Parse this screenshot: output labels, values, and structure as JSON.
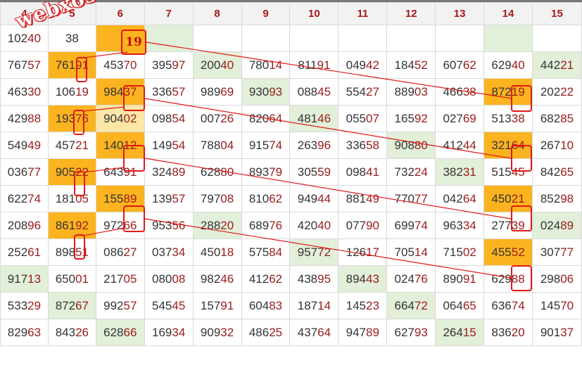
{
  "columns": [
    "4",
    "5",
    "6",
    "7",
    "8",
    "9",
    "10",
    "11",
    "12",
    "13",
    "14",
    "15"
  ],
  "rows": [
    [
      "10240",
      "38",
      "",
      "",
      "",
      "",
      "",
      "",
      "",
      "",
      "",
      ""
    ],
    [
      "76757",
      "76191",
      "45370",
      "39597",
      "20040",
      "78014",
      "81191",
      "04942",
      "18452",
      "60762",
      "62940",
      "44221"
    ],
    [
      "46330",
      "10619",
      "98437",
      "33657",
      "98969",
      "93093",
      "08845",
      "55427",
      "88903",
      "46638",
      "87219",
      "20222"
    ],
    [
      "42988",
      "19376",
      "90402",
      "09854",
      "00726",
      "82064",
      "48146",
      "05507",
      "16592",
      "02769",
      "51338",
      "68285"
    ],
    [
      "54949",
      "45721",
      "14012",
      "14954",
      "78804",
      "91574",
      "26396",
      "33658",
      "90880",
      "41244",
      "32164",
      "26710"
    ],
    [
      "03677",
      "90522",
      "64391",
      "32489",
      "62880",
      "89379",
      "30559",
      "09841",
      "73224",
      "38231",
      "51545",
      "84265"
    ],
    [
      "62274",
      "18105",
      "15589",
      "13957",
      "79708",
      "81062",
      "94944",
      "88149",
      "77077",
      "04264",
      "45021",
      "85298"
    ],
    [
      "20896",
      "86192",
      "97266",
      "95356",
      "28820",
      "68976",
      "42040",
      "07790",
      "69974",
      "96334",
      "27739",
      "02489"
    ],
    [
      "25261",
      "89851",
      "08627",
      "03734",
      "45018",
      "57584",
      "95772",
      "12617",
      "70514",
      "71502",
      "45552",
      "30777"
    ],
    [
      "91713",
      "65001",
      "21705",
      "08008",
      "98246",
      "41262",
      "43895",
      "89443",
      "02476",
      "89091",
      "62988",
      "29806"
    ],
    [
      "53329",
      "87267",
      "99257",
      "54545",
      "15791",
      "60483",
      "18714",
      "14523",
      "66472",
      "06465",
      "63674",
      "14570"
    ],
    [
      "82963",
      "84326",
      "62866",
      "16934",
      "90932",
      "48625",
      "43764",
      "94789",
      "62793",
      "26415",
      "83620",
      "90137"
    ]
  ],
  "highlight_number": "19",
  "watermark": "webxoso.net",
  "colors": {
    "header_text": "#a81818",
    "orange": "#fbb41f",
    "green": "#e2efd9",
    "light_yellow": "#fde6a6",
    "red": "#e21818"
  }
}
